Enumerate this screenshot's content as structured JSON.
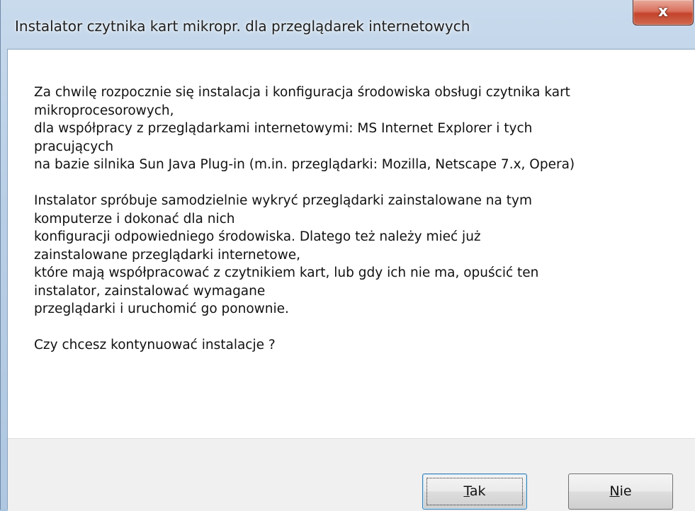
{
  "window": {
    "title": "Instalator czytnika kart mikropr. dla przeglądarek internetowych",
    "close_glyph": "x"
  },
  "message": {
    "paragraph1": [
      "Za chwilę rozpocznie się instalacja i konfiguracja środowiska obsługi czytnika kart",
      "mikroprocesorowych,",
      "dla współpracy z przeglądarkami internetowymi: MS Internet Explorer i tych",
      "pracujących",
      "na bazie silnika Sun Java Plug-in (m.in. przeglądarki: Mozilla, Netscape 7.x, Opera)"
    ],
    "paragraph2": [
      "Instalator spróbuje samodzielnie wykryć przeglądarki zainstalowane na tym",
      "komputerze i dokonać dla nich",
      "konfiguracji odpowiedniego środowiska. Dlatego też należy mieć już",
      "zainstalowane przeglądarki internetowe,",
      "które mają współpracować z czytnikiem kart, lub gdy ich nie ma, opuścić ten",
      "instalator, zainstalować wymagane",
      "przeglądarki i uruchomić go ponownie."
    ],
    "question": "Czy chcesz kontynuować instalacje ?"
  },
  "buttons": {
    "yes": {
      "mnemonic": "T",
      "rest": "ak"
    },
    "no": {
      "mnemonic": "N",
      "rest": "ie"
    }
  },
  "colors": {
    "title_bar": "#b9cfe6",
    "close_button": "#c5432c",
    "content_background": "#ffffff",
    "button_bar_background": "#f0f0f0",
    "default_button_border": "#3c7fb1"
  },
  "icons": {
    "close": "close-icon"
  }
}
